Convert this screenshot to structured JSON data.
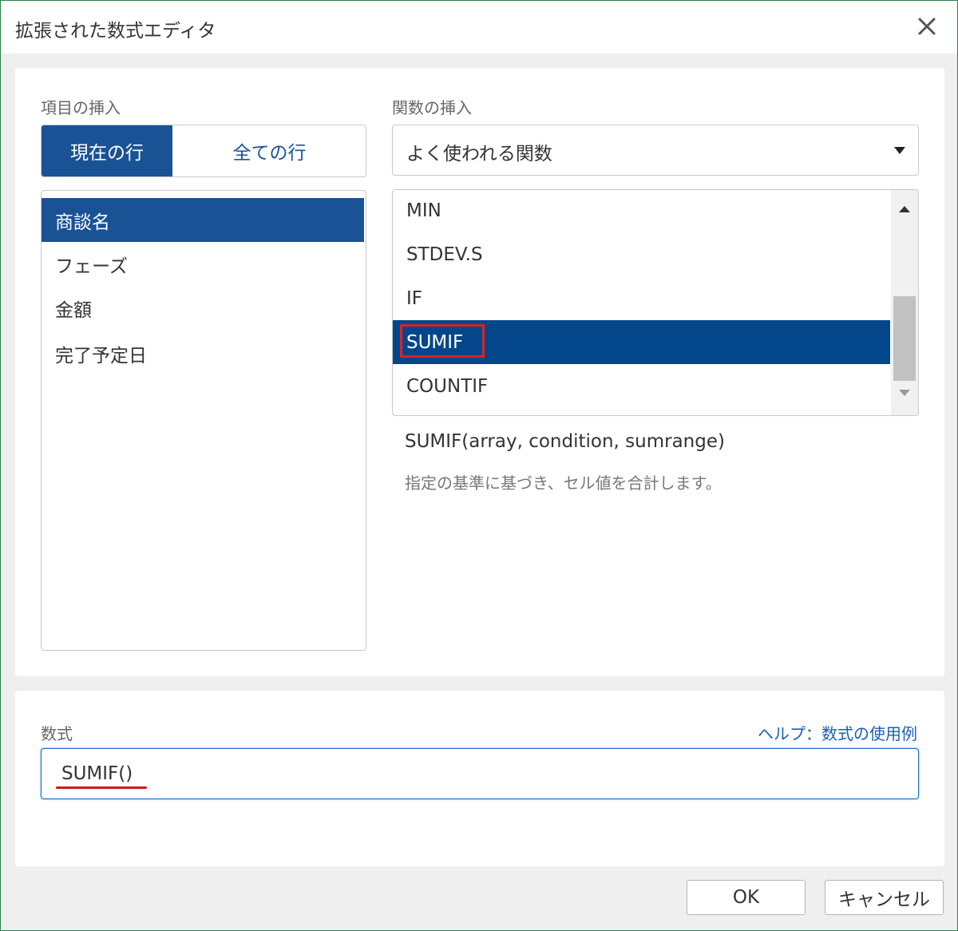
{
  "dialog": {
    "title": "拡張された数式エディタ"
  },
  "fields": {
    "section_label": "項目の挿入",
    "toggle": {
      "current_row": "現在の行",
      "all_rows": "全ての行"
    },
    "items": [
      "商談名",
      "フェーズ",
      "金額",
      "完了予定日"
    ],
    "selected_item": "商談名"
  },
  "functions": {
    "section_label": "関数の挿入",
    "category_select": "よく使われる関数",
    "items": [
      "MIN",
      "STDEV.S",
      "IF",
      "SUMIF",
      "COUNTIF"
    ],
    "selected": "SUMIF",
    "signature": "SUMIF(array, condition, sumrange)",
    "description": "指定の基準に基づき、セル値を合計します。"
  },
  "formula": {
    "label": "数式",
    "help_link": "ヘルプ：数式の使用例",
    "value": "SUMIF()"
  },
  "buttons": {
    "ok": "OK",
    "cancel": "キャンセル"
  },
  "colors": {
    "primary": "#1a5296",
    "selected_row": "#03468a",
    "highlight": "#e02020",
    "link": "#1a5fb4"
  }
}
